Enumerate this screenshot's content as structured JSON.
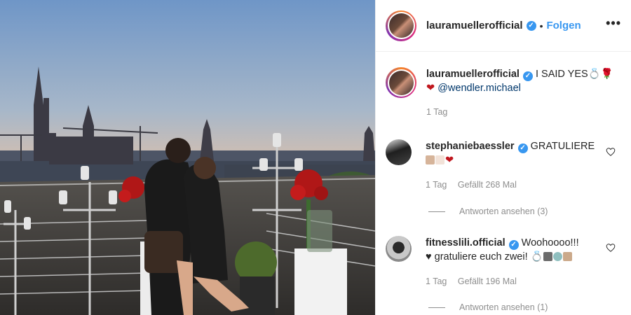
{
  "post": {
    "author": "lauramuellerofficial",
    "follow_label": "Folgen",
    "dot": "•",
    "more_label": "•••",
    "verified_mark": "✓"
  },
  "caption": {
    "user": "lauramuellerofficial",
    "text": "I SAID YES💍🌹",
    "heart": "❤",
    "mention": "@wendler.michael",
    "time": "1 Tag"
  },
  "comments": [
    {
      "user": "stephaniebaessler",
      "text": "GRATULIERE",
      "line2_heart": "❤",
      "time": "1 Tag",
      "likes": "Gefällt 268 Mal",
      "replies": "Antworten ansehen (3)"
    },
    {
      "user": "fitnesslili.official",
      "text": "Woohoooo!!!",
      "line2_heart": "♥",
      "line2_text": "gratuliere euch zwei!",
      "line2_ring": "💍",
      "time": "1 Tag",
      "likes": "Gefällt 196 Mal",
      "replies": "Antworten ansehen (1)"
    }
  ],
  "colors": {
    "accent": "#3897f0",
    "secondary_text": "#8e8e8e",
    "mention": "#00376b",
    "heart": "#c0171e"
  }
}
